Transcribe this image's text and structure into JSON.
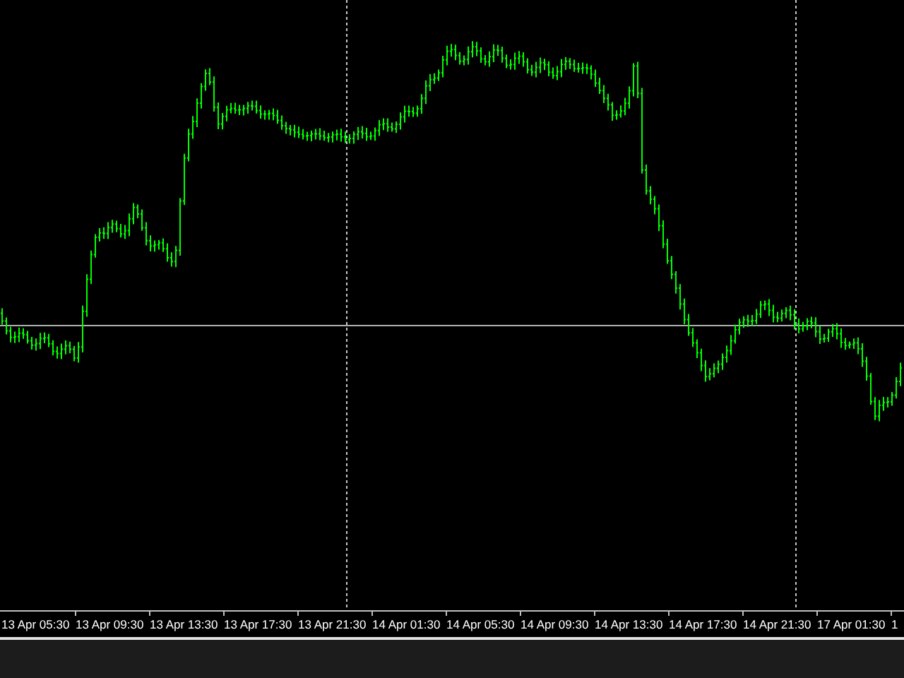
{
  "time_axis": {
    "labels": [
      "13 Apr 05:30",
      "13 Apr 09:30",
      "13 Apr 13:30",
      "13 Apr 17:30",
      "13 Apr 21:30",
      "14 Apr 01:30",
      "14 Apr 05:30",
      "14 Apr 09:30",
      "14 Apr 13:30",
      "14 Apr 17:30",
      "14 Apr 21:30",
      "17 Apr 01:30",
      "1"
    ]
  }
}
